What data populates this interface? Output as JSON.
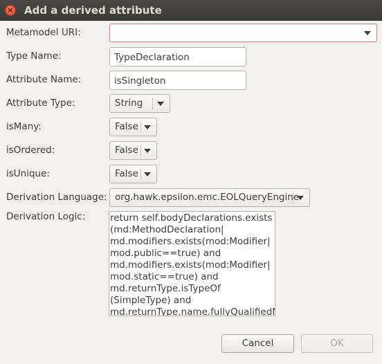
{
  "window": {
    "title": "Add a derived attribute"
  },
  "form": {
    "metamodel_uri": {
      "label": "Metamodel URI:",
      "value": ""
    },
    "type_name": {
      "label": "Type Name:",
      "value": "TypeDeclaration"
    },
    "attribute_name": {
      "label": "Attribute Name:",
      "value": "isSingleton"
    },
    "attribute_type": {
      "label": "Attribute Type:",
      "value": "String"
    },
    "is_many": {
      "label": "isMany:",
      "value": "False"
    },
    "is_ordered": {
      "label": "isOrdered:",
      "value": "False"
    },
    "is_unique": {
      "label": "isUnique:",
      "value": "False"
    },
    "derivation_language": {
      "label": "Derivation Language:",
      "value": "org.hawk.epsilon.emc.EOLQueryEngine"
    },
    "derivation_logic": {
      "label": "Derivation Logic:",
      "lines": [
        "return self.bodyDeclarations.exists",
        "(md:MethodDeclaration|",
        "md.modifiers.exists(mod:Modifier|",
        "mod.public==true) and",
        "md.modifiers.exists(mod:Modifier|",
        "mod.static==true) and",
        "md.returnType.isTypeOf",
        "(SimpleType) and",
        "md.returnType.name.fullyQualifiedN"
      ]
    }
  },
  "buttons": {
    "cancel": "Cancel",
    "ok": "OK"
  },
  "colors": {
    "titlebar": "#3c3b37",
    "close": "#e0482a",
    "uri_border": "#e07a5f"
  },
  "icons": {
    "close": "close-icon",
    "dropdown": "chevron-down-icon"
  }
}
